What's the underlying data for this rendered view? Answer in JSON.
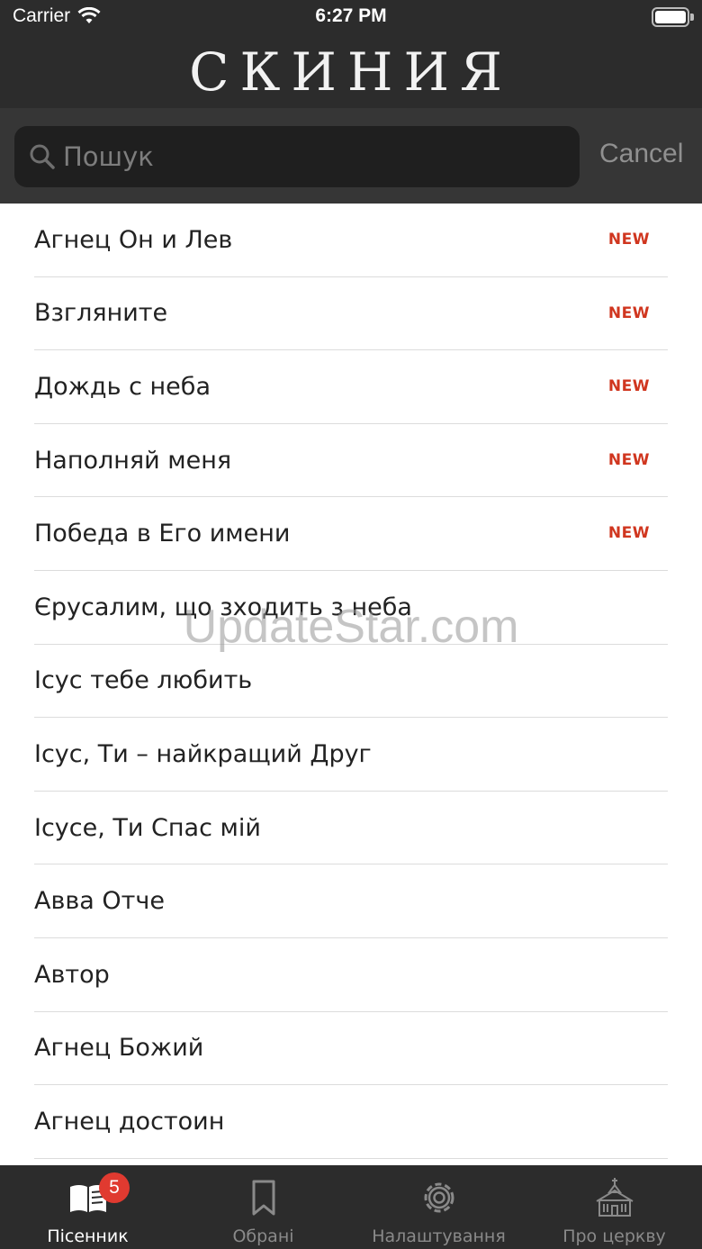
{
  "status_bar": {
    "carrier": "Carrier",
    "time": "6:27 PM"
  },
  "header": {
    "logo_text": "СКИНИЯ"
  },
  "search": {
    "placeholder": "Пошук",
    "value": "",
    "cancel_label": "Cancel"
  },
  "songs": [
    {
      "title": "Агнец Он и Лев",
      "badge": "NEW"
    },
    {
      "title": "Взгляните",
      "badge": "NEW"
    },
    {
      "title": "Дождь с неба",
      "badge": "NEW"
    },
    {
      "title": "Наполняй меня",
      "badge": "NEW"
    },
    {
      "title": "Победа в Его имени",
      "badge": "NEW"
    },
    {
      "title": "Єрусалим, що зходить з неба",
      "badge": ""
    },
    {
      "title": "Ісус тебе любить",
      "badge": ""
    },
    {
      "title": "Ісус, Ти  – найкращий Друг",
      "badge": ""
    },
    {
      "title": "Ісусе, Ти Спас мій",
      "badge": ""
    },
    {
      "title": "Авва Отче",
      "badge": ""
    },
    {
      "title": "Автор",
      "badge": ""
    },
    {
      "title": "Агнец Божий",
      "badge": ""
    },
    {
      "title": "Агнец достоин",
      "badge": ""
    }
  ],
  "watermark": "UpdateStar.com",
  "tabs": [
    {
      "label": "Пісенник",
      "icon": "book-icon",
      "badge": "5",
      "active": true
    },
    {
      "label": "Обрані",
      "icon": "bookmark-icon",
      "badge": "",
      "active": false
    },
    {
      "label": "Налаштування",
      "icon": "gear-icon",
      "badge": "",
      "active": false
    },
    {
      "label": "Про церкву",
      "icon": "church-icon",
      "badge": "",
      "active": false
    }
  ],
  "colors": {
    "bar_background": "#2c2c2c",
    "new_badge": "#d0361f",
    "tab_badge": "#e03a30"
  }
}
